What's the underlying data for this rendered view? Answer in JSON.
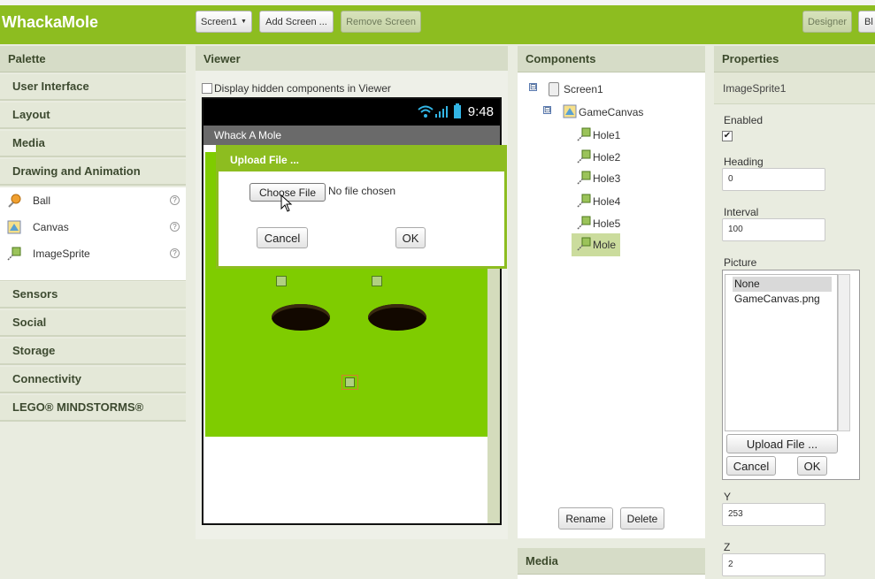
{
  "app": {
    "title": "WhackaMole",
    "screen_select": "Screen1",
    "add_screen": "Add Screen ...",
    "remove_screen": "Remove Screen",
    "designer": "Designer",
    "blocks": "Bl"
  },
  "palette": {
    "title": "Palette",
    "categories_top": [
      "User Interface",
      "Layout",
      "Media",
      "Drawing and Animation"
    ],
    "items": [
      {
        "label": "Ball",
        "icon": "ball-icon"
      },
      {
        "label": "Canvas",
        "icon": "canvas-icon"
      },
      {
        "label": "ImageSprite",
        "icon": "image-sprite-icon"
      }
    ],
    "help_glyph": "?",
    "categories_bottom": [
      "Sensors",
      "Social",
      "Storage",
      "Connectivity",
      "LEGO® MINDSTORMS®"
    ]
  },
  "viewer": {
    "title": "Viewer",
    "hidden_checkbox_label": "Display hidden components in Viewer",
    "clock": "9:48",
    "app_title": "Whack A Mole"
  },
  "upload_dialog": {
    "title": "Upload File ...",
    "choose_file": "Choose File",
    "no_file": "No file chosen",
    "cancel": "Cancel",
    "ok": "OK"
  },
  "components": {
    "title": "Components",
    "tree": [
      "Screen1",
      "GameCanvas",
      "Hole1",
      "Hole2",
      "Hole3",
      "Hole4",
      "Hole5",
      "Mole"
    ],
    "selected": "Mole",
    "toggle_glyph": "⊟",
    "rename": "Rename",
    "delete": "Delete"
  },
  "media": {
    "title": "Media"
  },
  "properties": {
    "title": "Properties",
    "component_name": "ImageSprite1",
    "enabled_label": "Enabled",
    "enabled_checked": true,
    "heading_label": "Heading",
    "heading_value": "0",
    "interval_label": "Interval",
    "interval_value": "100",
    "picture_label": "Picture",
    "picture_options": [
      "None",
      "GameCanvas.png"
    ],
    "upload_file": "Upload File ...",
    "cancel": "Cancel",
    "ok": "OK",
    "y_label": "Y",
    "y_value": "253",
    "z_label": "Z",
    "z_value": "2"
  },
  "colors": {
    "brand_green": "#8dbd20",
    "canvas_green": "#7fcc00",
    "selected_bg": "#cbdc9d"
  }
}
